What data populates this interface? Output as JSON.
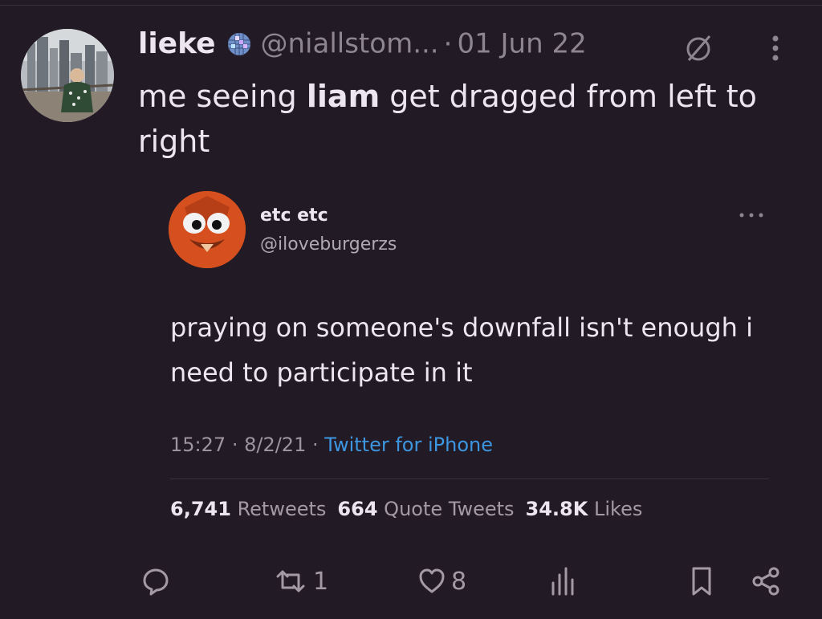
{
  "tweet": {
    "author": "lieke",
    "handle": "@niallstom...",
    "separator": "·",
    "date": "01 Jun 22",
    "text_before": "me seeing ",
    "text_bold": "liam",
    "text_after": " get dragged from left to right",
    "badge_icon": "disco-ball-icon",
    "status_icon": "slashed-circle-icon"
  },
  "quote": {
    "name": "etc etc",
    "handle": "@iloveburgerzs",
    "text": "praying on someone's downfall isn't enough i need to participate in it",
    "time": "15:27",
    "dot1": "·",
    "date": "8/2/21",
    "dot2": "·",
    "source": "Twitter for iPhone",
    "retweets_count": "6,741",
    "retweets_label": "Retweets",
    "quotes_count": "664",
    "quotes_label": "Quote Tweets",
    "likes_count": "34.8K",
    "likes_label": "Likes"
  },
  "actions": {
    "reply_count": "",
    "retweet_count": "1",
    "like_count": "8",
    "views_count": ""
  },
  "colors": {
    "background": "#221a24",
    "text": "#ece6ee",
    "muted": "#8d8591",
    "link": "#3d96e0"
  }
}
